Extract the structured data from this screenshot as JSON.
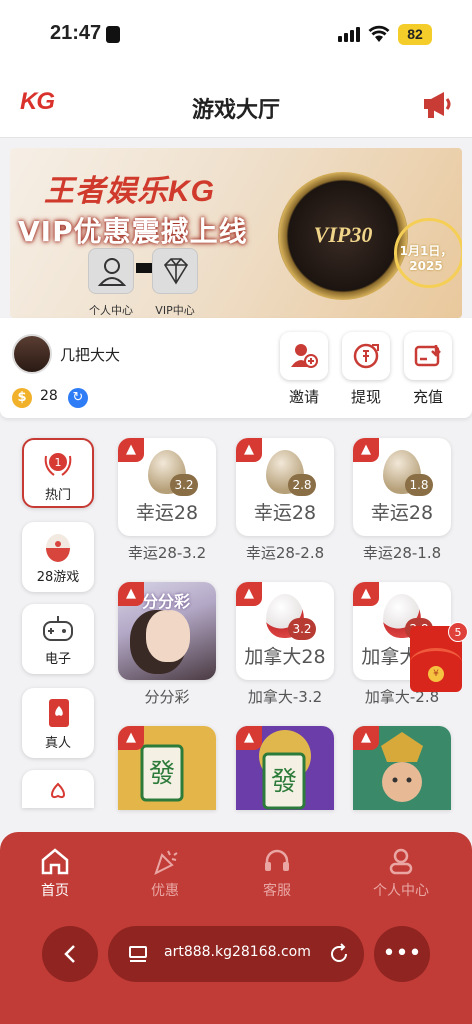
{
  "status": {
    "time": "21:47",
    "battery": "82"
  },
  "header": {
    "logo": "KG",
    "title": "游戏大厅"
  },
  "banner": {
    "title": "王者娱乐KG",
    "subtitle": "VIP优惠震撼上线",
    "left_caption": "个人中心",
    "right_caption": "VIP中心",
    "vip_badge": "VIP30",
    "date": "1月1日，2025"
  },
  "user": {
    "name": "几把大大",
    "balance": "28",
    "coin_symbol": "$"
  },
  "actions": [
    {
      "label": "邀请",
      "icon": "invite-icon"
    },
    {
      "label": "提现",
      "icon": "withdraw-icon"
    },
    {
      "label": "充值",
      "icon": "recharge-icon"
    }
  ],
  "sidebar": [
    {
      "label": "热门",
      "icon": "hot-icon",
      "active": true
    },
    {
      "label": "28游戏",
      "icon": "egg-icon"
    },
    {
      "label": "电子",
      "icon": "gamepad-icon"
    },
    {
      "label": "真人",
      "icon": "cards-icon"
    },
    {
      "label": "",
      "icon": "spade-icon"
    }
  ],
  "games": [
    {
      "name": "幸运28",
      "badge": "3.2",
      "caption": "幸运28-3.2"
    },
    {
      "name": "幸运28",
      "badge": "2.8",
      "caption": "幸运28-2.8"
    },
    {
      "name": "幸运28",
      "badge": "1.8",
      "caption": "幸运28-1.8"
    },
    {
      "name": "分分彩",
      "caption": "分分彩"
    },
    {
      "name": "加拿大28",
      "badge": "3.2",
      "caption": "加拿大-3.2"
    },
    {
      "name": "加拿大28",
      "badge": "2.8",
      "caption": "加拿大-2.8"
    },
    {
      "name": "",
      "caption": ""
    },
    {
      "name": "",
      "caption": ""
    },
    {
      "name": "",
      "caption": ""
    }
  ],
  "red_packet": {
    "count": "5",
    "symbol": "¥"
  },
  "tabs": [
    {
      "label": "首页",
      "icon": "home-icon",
      "active": true
    },
    {
      "label": "优惠",
      "icon": "party-icon"
    },
    {
      "label": "客服",
      "icon": "headset-icon"
    },
    {
      "label": "个人中心",
      "icon": "user-icon"
    }
  ],
  "browser": {
    "url": "art888.kg28168.com"
  },
  "colors": {
    "brand_red": "#c13c37",
    "accent": "#d63a33"
  }
}
